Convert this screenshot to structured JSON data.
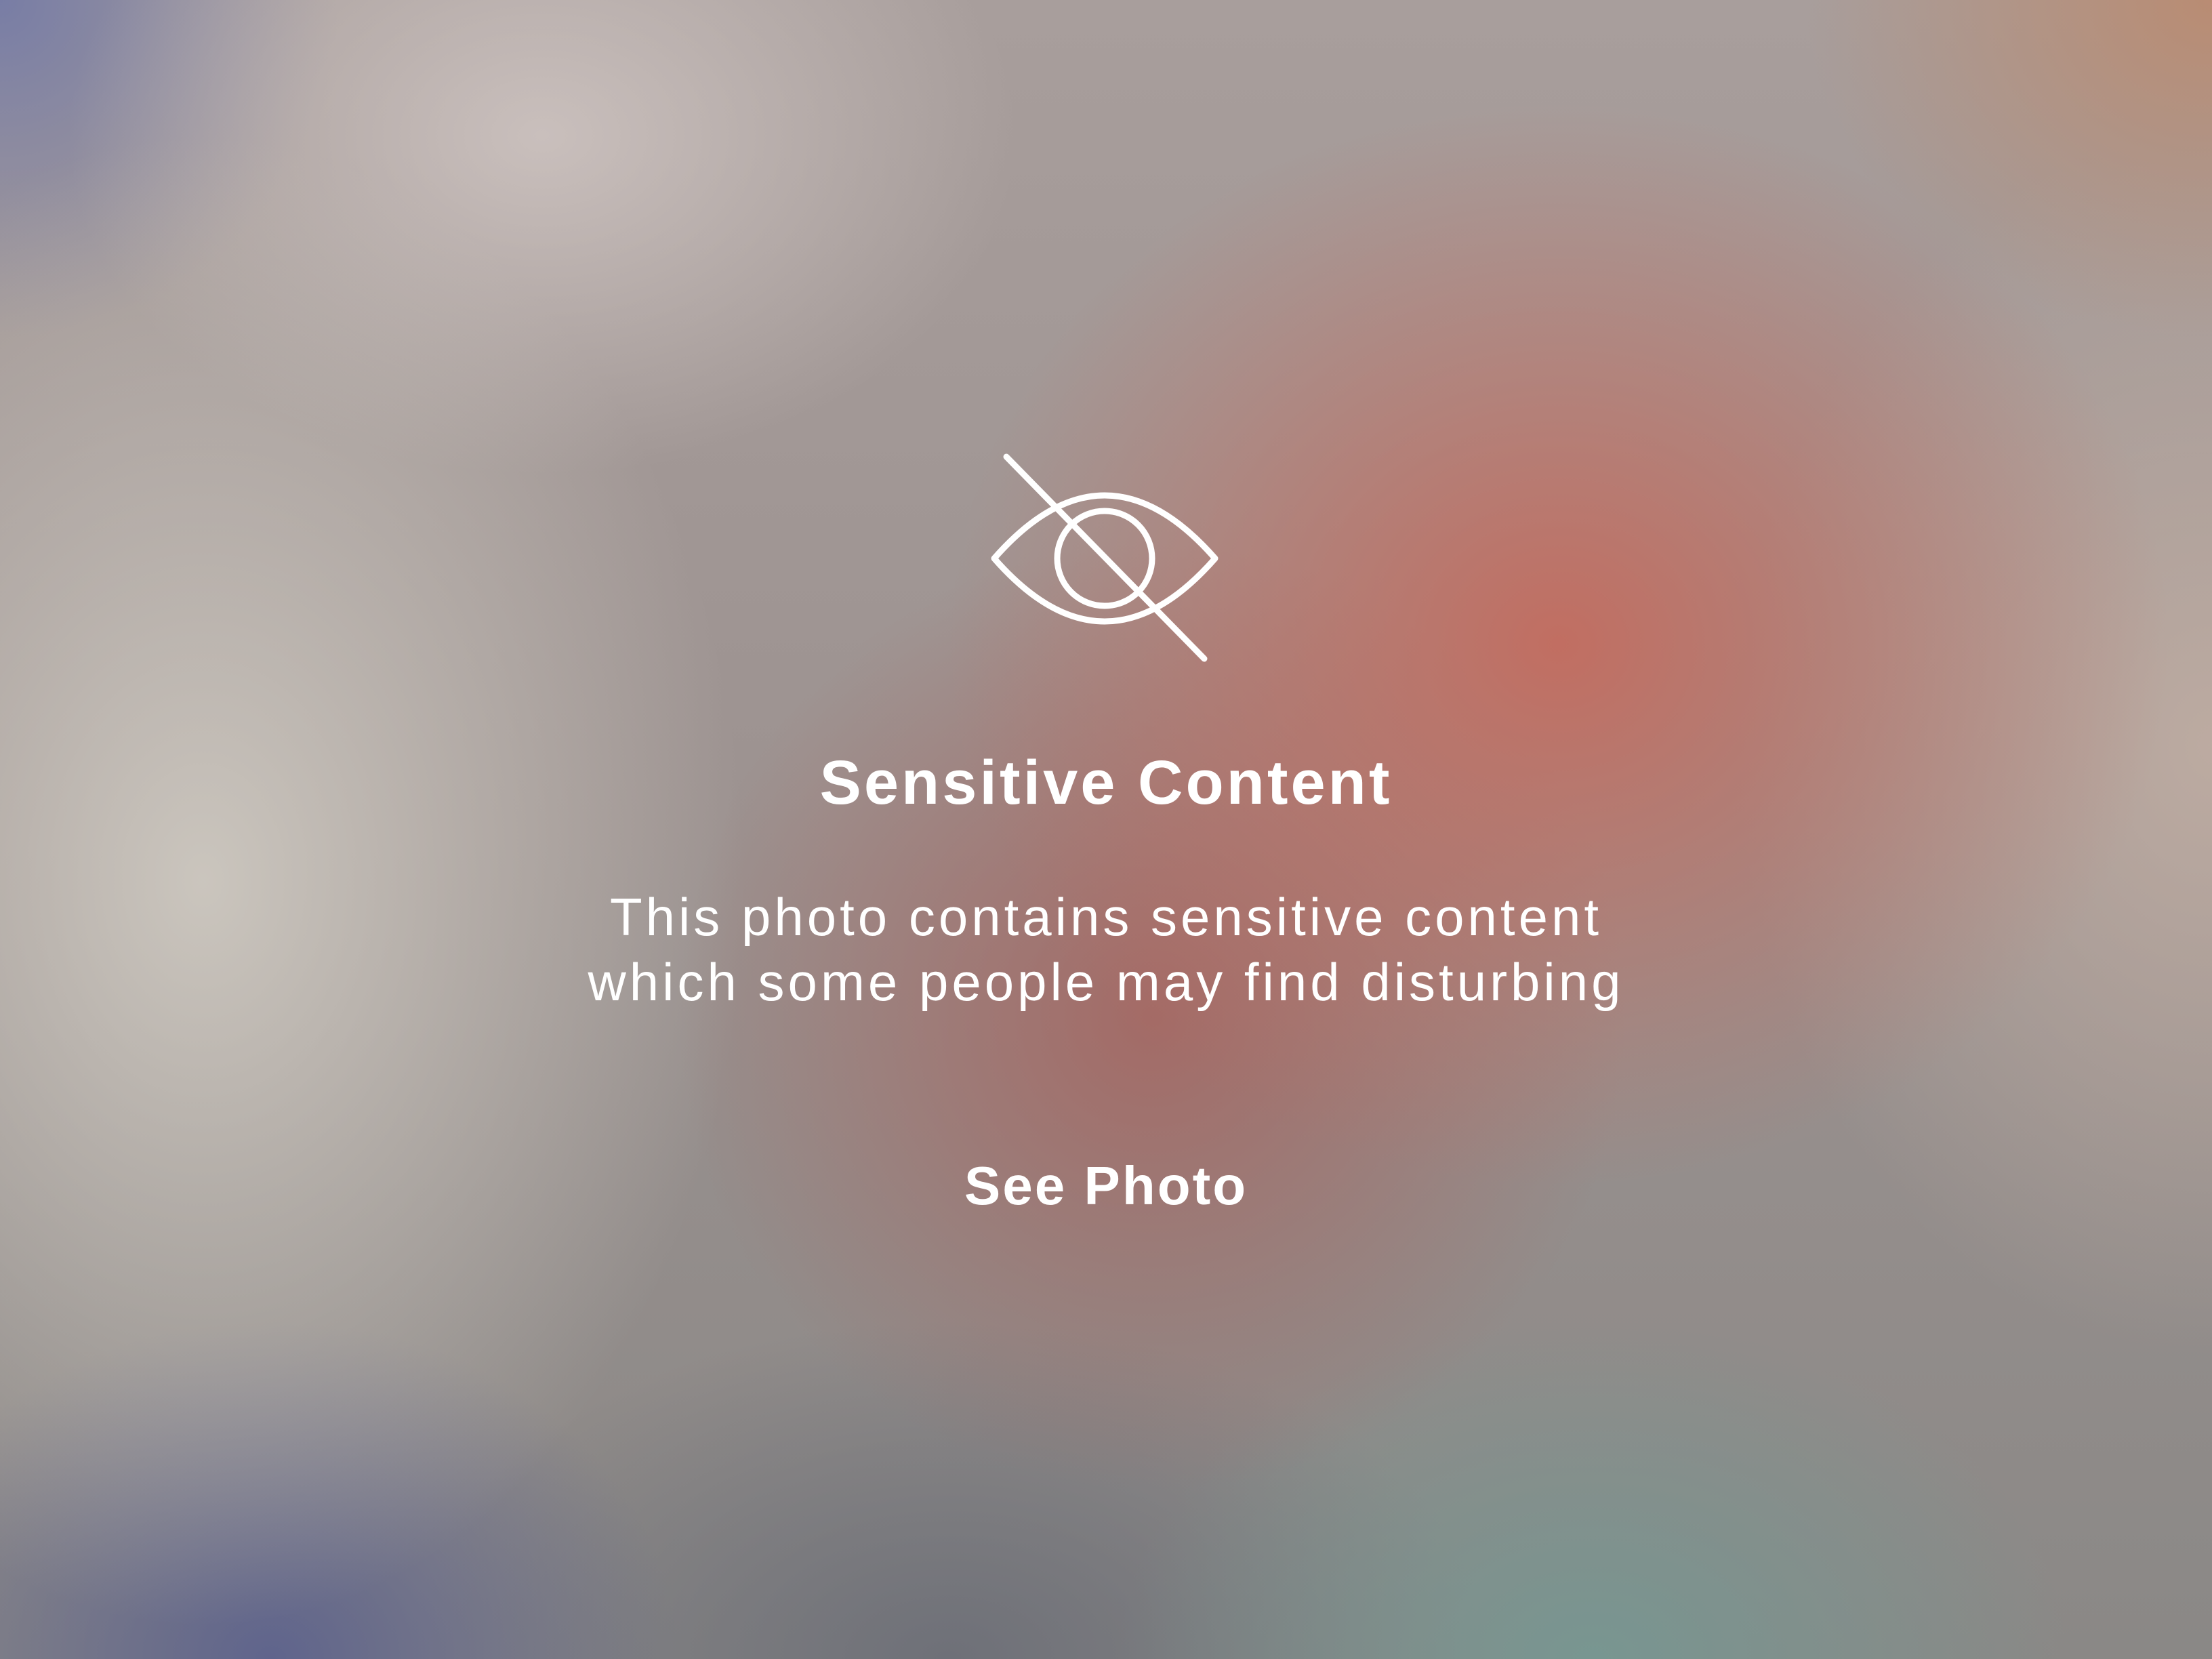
{
  "sensitive_overlay": {
    "icon": "eye-slash-icon",
    "title": "Sensitive Content",
    "message_line_1": "This photo contains sensitive content",
    "message_line_2": "which some people may find disturbing",
    "see_photo_label": "See Photo",
    "text_color": "#ffffff"
  }
}
